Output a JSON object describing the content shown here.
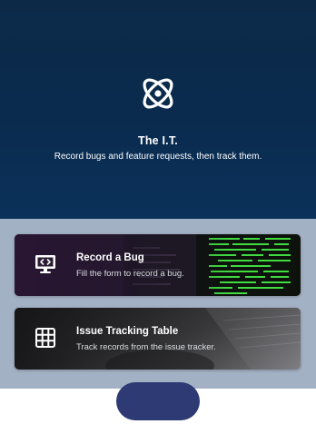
{
  "app": {
    "title": "The I.T.",
    "tagline": "Record bugs and feature requests, then track them.",
    "logo_icon": "atom-icon"
  },
  "cards": [
    {
      "title": "Record a Bug",
      "description": "Fill the form to record a bug.",
      "icon": "monitor-code-icon"
    },
    {
      "title": "Issue Tracking Table",
      "description": "Track records from the issue tracker.",
      "icon": "grid-table-icon"
    }
  ],
  "colors": {
    "hero_bg": "#0a2b4e",
    "cards_area_bg": "#a3b1c4",
    "fab": "#2e3a73"
  }
}
